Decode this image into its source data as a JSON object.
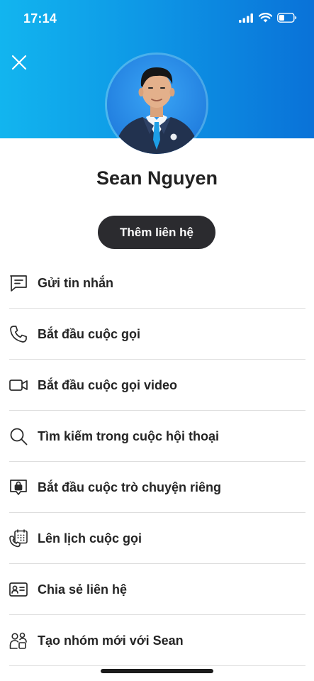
{
  "status_bar": {
    "time": "17:14",
    "icons": [
      "cellular-signal-icon",
      "wifi-icon",
      "battery-icon"
    ]
  },
  "header": {
    "background_start": "#12b5ef",
    "background_end": "#0a72d8",
    "close_icon": "close-icon"
  },
  "profile": {
    "name": "Sean Nguyen",
    "add_contact_label": "Thêm liên hệ"
  },
  "menu": {
    "items": [
      {
        "label": "Gửi tin nhắn",
        "icon": "message-icon"
      },
      {
        "label": "Bắt đầu cuộc gọi",
        "icon": "phone-icon"
      },
      {
        "label": "Bắt đầu cuộc gọi video",
        "icon": "video-camera-icon"
      },
      {
        "label": "Tìm kiếm trong cuộc hội thoại",
        "icon": "search-icon"
      },
      {
        "label": "Bắt đầu cuộc trò chuyện riêng",
        "icon": "private-chat-lock-icon"
      },
      {
        "label": "Lên lịch cuộc gọi",
        "icon": "schedule-call-icon"
      },
      {
        "label": "Chia sẻ liên hệ",
        "icon": "contact-card-icon"
      },
      {
        "label": "Tạo nhóm mới với Sean",
        "icon": "new-group-icon"
      }
    ]
  }
}
